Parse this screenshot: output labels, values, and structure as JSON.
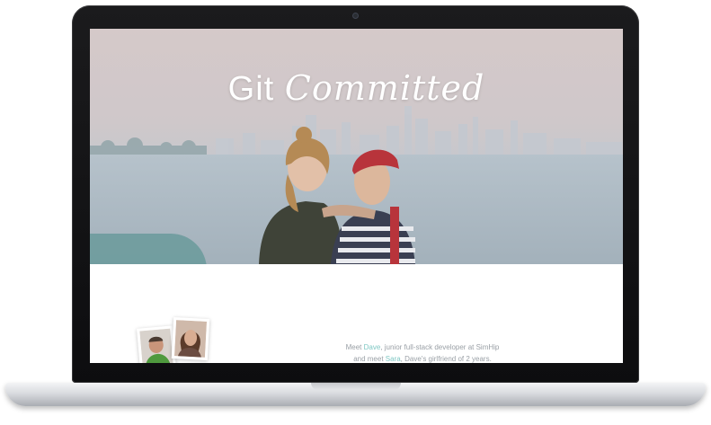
{
  "hero": {
    "title_part1": "Git",
    "title_part2": "Committed"
  },
  "intro": {
    "line1_pre": "Meet ",
    "line1_name": "Dave",
    "line1_post": ", junior full-stack developer at SimHip",
    "line2_pre": "and meet ",
    "line2_name": "Sara",
    "line2_post": ", Dave's girlfriend of 2 years."
  },
  "colors": {
    "accent": "#7fc8c4",
    "bezel": "#111113",
    "text_muted": "#9aa0a6"
  }
}
